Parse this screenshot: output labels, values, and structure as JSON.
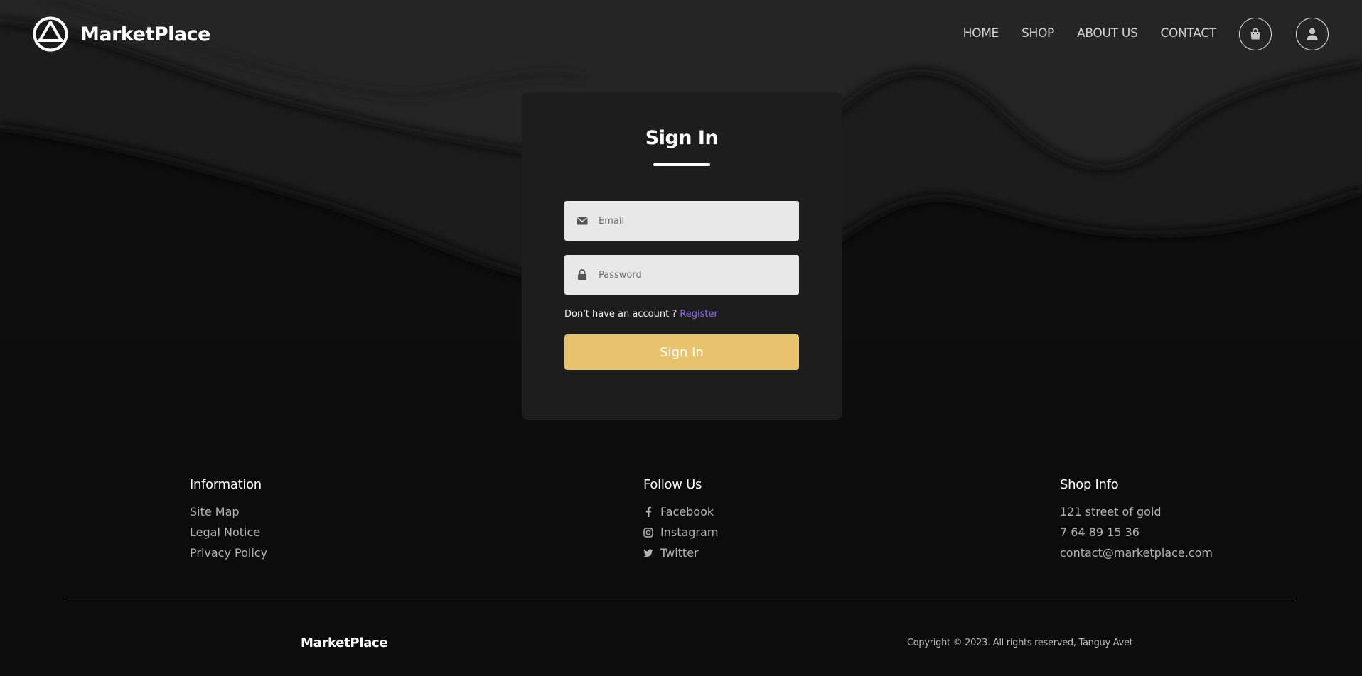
{
  "header": {
    "brand": "MarketPlace",
    "nav": [
      "HOME",
      "SHOP",
      "ABOUT US",
      "CONTACT"
    ],
    "icons": {
      "cart": "shopping-bag-icon",
      "account": "user-icon"
    }
  },
  "signin": {
    "title": "Sign In",
    "email_placeholder": "Email",
    "password_placeholder": "Password",
    "no_account_text": "Don't have an account ?",
    "register_link": "Register",
    "submit_label": "Sign In"
  },
  "footer": {
    "information": {
      "heading": "Information",
      "items": [
        "Site Map",
        "Legal Notice",
        "Privacy Policy"
      ]
    },
    "follow": {
      "heading": "Follow Us",
      "items": [
        "Facebook",
        "Instagram",
        "Twitter"
      ]
    },
    "shop_info": {
      "heading": "Shop Info",
      "items": [
        "121 street of gold",
        "7 64 89 15 36",
        "contact@marketplace.com"
      ]
    },
    "brand": "MarketPlace",
    "copyright": "Copyright © 2023. All rights reserved, Tanguy Avet"
  },
  "colors": {
    "page_bg": "#0c0c0c",
    "card_bg": "#1d1d1d",
    "accent": "#e6c36c",
    "link": "#8f6cf0"
  }
}
